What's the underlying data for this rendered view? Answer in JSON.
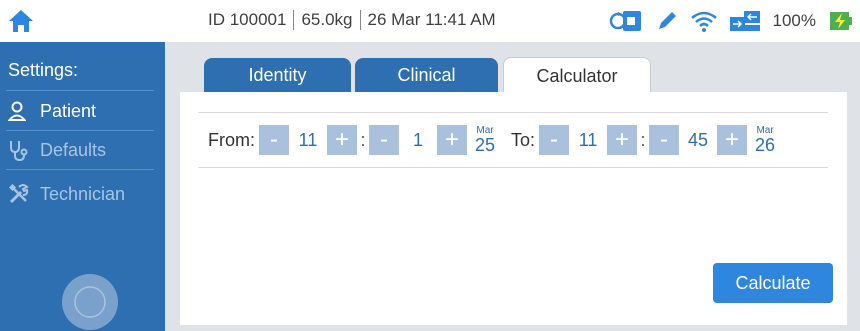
{
  "status": {
    "patient_id": "ID 100001",
    "weight": "65.0kg",
    "datetime": "26 Mar  11:41 AM",
    "battery": "100%"
  },
  "sidebar": {
    "title": "Settings:",
    "items": [
      {
        "label": "Patient",
        "icon": "person-icon"
      },
      {
        "label": "Defaults",
        "icon": "stethoscope-icon"
      },
      {
        "label": "Technician",
        "icon": "tools-icon"
      }
    ]
  },
  "tabs": [
    {
      "label": "Identity",
      "state": "inactive"
    },
    {
      "label": "Clinical",
      "state": "inactive"
    },
    {
      "label": "Calculator",
      "state": "active"
    }
  ],
  "calculator": {
    "from_label": "From:",
    "to_label": "To:",
    "from": {
      "hour": "11",
      "minute": "1",
      "month": "Mar",
      "day": "25"
    },
    "to": {
      "hour": "11",
      "minute": "45",
      "month": "Mar",
      "day": "26"
    },
    "minus": "-",
    "plus": "+",
    "colon": ":",
    "calculate_label": "Calculate"
  },
  "colors": {
    "primary": "#2d6fb0",
    "button_accent": "#2e86de",
    "stepper": "#a9c1dd",
    "battery_charging": "#4caf50"
  }
}
